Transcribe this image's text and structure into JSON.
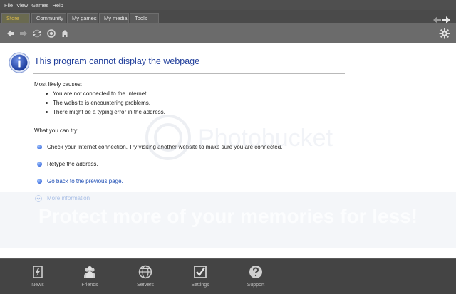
{
  "menu": {
    "items": [
      "File",
      "View",
      "Games",
      "Help"
    ]
  },
  "tabs": [
    {
      "label": "Store",
      "active": true
    },
    {
      "label": "Community",
      "active": false
    },
    {
      "label": "My games",
      "active": false
    },
    {
      "label": "My media",
      "active": false
    },
    {
      "label": "Tools",
      "active": false
    }
  ],
  "toolbar": {
    "icons": [
      "back-arrow-icon",
      "forward-arrow-icon",
      "refresh-icon",
      "stop-icon",
      "home-icon",
      "gear-icon"
    ]
  },
  "error_page": {
    "title": "This program cannot display the webpage",
    "causes_heading": "Most likely causes:",
    "causes": [
      "You are not connected to the Internet.",
      "The website is encountering problems.",
      "There might be a typing error in the address."
    ],
    "try_heading": "What you can try:",
    "try_items": [
      "Check your Internet connection. Try visiting another website to make sure you are connected.",
      "Retype the address.",
      "Go back to the previous page."
    ],
    "more_info": "More information"
  },
  "watermark": {
    "logo": "Photobucket",
    "band_text": "Protect more of your memories for less!"
  },
  "bottom_nav": [
    {
      "label": "News",
      "icon": "news-icon"
    },
    {
      "label": "Friends",
      "icon": "friends-icon"
    },
    {
      "label": "Servers",
      "icon": "globe-icon"
    },
    {
      "label": "Settings",
      "icon": "checkbox-icon"
    },
    {
      "label": "Support",
      "icon": "question-icon"
    }
  ],
  "colors": {
    "active_tab_text": "#d8b84a",
    "title_blue": "#1f3d9a",
    "link_blue": "#1f4fb5",
    "chrome_dark": "#4a4a4a",
    "toolbar_gray": "#6b6b6b"
  }
}
